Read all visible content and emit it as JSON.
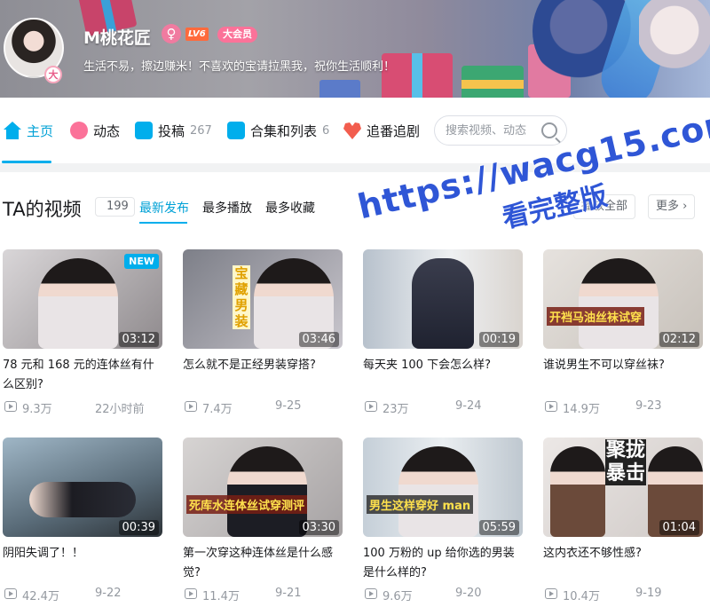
{
  "profile": {
    "username": "M桃花匠",
    "gender_symbol": "♀",
    "level": "LV6",
    "vip": "大会员",
    "avatar_badge": "大",
    "signature": "生活不易，擦边赚米！不喜欢的宝请拉黑我，祝你生活顺利！"
  },
  "nav": {
    "tabs": [
      {
        "label": "主页",
        "icon": "home-icon",
        "count": ""
      },
      {
        "label": "动态",
        "icon": "dynamic-icon",
        "count": ""
      },
      {
        "label": "投稿",
        "icon": "upload-icon",
        "count": "267"
      },
      {
        "label": "合集和列表",
        "icon": "collection-icon",
        "count": "6"
      },
      {
        "label": "追番追剧",
        "icon": "bangumi-heart-icon",
        "count": ""
      }
    ],
    "active_tab": "主页",
    "search_placeholder": "搜索视频、动态"
  },
  "videos_section": {
    "title": "TA的视频",
    "count": "199",
    "sort_tabs": [
      "最新发布",
      "最多播放",
      "最多收藏"
    ],
    "active_sort": "最新发布",
    "play_all": "播放全部",
    "more": "更多"
  },
  "watermark": {
    "line1": "https://wacg15.com",
    "line2": "看完整版"
  },
  "videos": [
    {
      "title": "78 元和 168 元的连体丝有什么区别?",
      "duration": "03:12",
      "views": "9.3万",
      "date": "22小时前",
      "tag": "NEW",
      "caption": ""
    },
    {
      "title": "怎么就不是正经男装穿搭?",
      "duration": "03:46",
      "views": "7.4万",
      "date": "9-25",
      "tag": "",
      "caption": "宝藏男装"
    },
    {
      "title": "每天夹 100 下会怎么样?",
      "duration": "00:19",
      "views": "23万",
      "date": "9-24",
      "tag": "",
      "caption": ""
    },
    {
      "title": "谁说男生不可以穿丝袜?",
      "duration": "02:12",
      "views": "14.9万",
      "date": "9-23",
      "tag": "",
      "caption": "开裆马油丝袜试穿"
    },
    {
      "title": "阴阳失调了！！",
      "duration": "00:39",
      "views": "42.4万",
      "date": "9-22",
      "tag": "",
      "caption": ""
    },
    {
      "title": "第一次穿这种连体丝是什么感觉?",
      "duration": "03:30",
      "views": "11.4万",
      "date": "9-21",
      "tag": "",
      "caption": "死库水连体丝试穿测评"
    },
    {
      "title": "100 万粉的 up 给你选的男装是什么样的?",
      "duration": "05:59",
      "views": "9.6万",
      "date": "9-20",
      "tag": "",
      "caption": "男生这样穿好 man"
    },
    {
      "title": "这内衣还不够性感?",
      "duration": "01:04",
      "views": "10.4万",
      "date": "9-19",
      "tag": "",
      "caption": "聚拢暴击"
    }
  ],
  "colors": {
    "accent": "#00aeec",
    "pink": "#fb7299",
    "text": "#18191c",
    "muted": "#9499a0",
    "watermark": "#2f56d6"
  }
}
